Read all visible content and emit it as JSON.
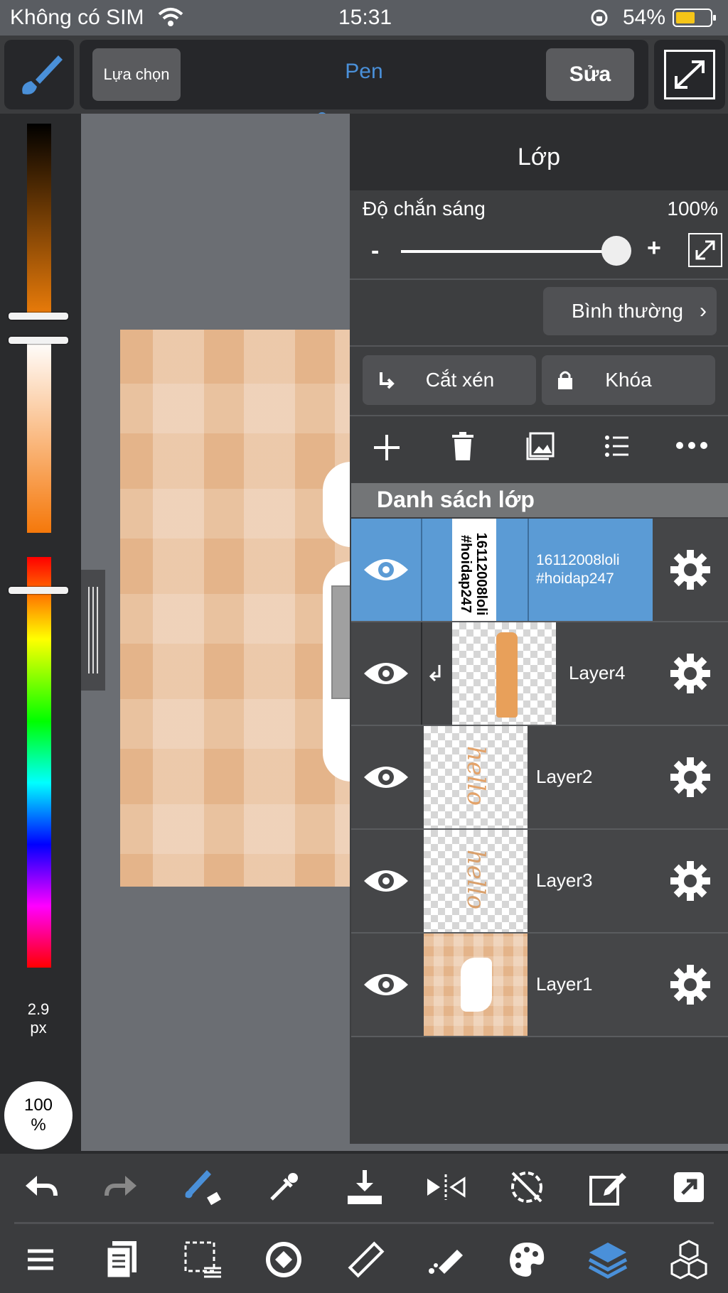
{
  "status": {
    "carrier": "Không có SIM",
    "time": "15:31",
    "battery": "54%"
  },
  "toolbar": {
    "selection_label": "Lựa chọn",
    "tool_name": "Pen",
    "edit_label": "Sửa"
  },
  "left": {
    "brush_size": "2.9",
    "brush_unit": "px",
    "opacity_value": "100",
    "opacity_unit": "%"
  },
  "panel": {
    "title": "Lớp",
    "opacity_label": "Độ chắn sáng",
    "opacity_value": "100%",
    "opacity_level": 1.0,
    "minus": "-",
    "plus": "+",
    "blend_mode": "Bình thường",
    "clip_label": "Cắt xén",
    "lock_label": "Khóa",
    "list_header": "Danh sách lớp",
    "layers": [
      {
        "name_line1": "16112008loli",
        "name_line2": "#hoidap247",
        "thumb_line1": "16112008loli",
        "thumb_line2": "#hoidap247"
      },
      {
        "name": "Layer4"
      },
      {
        "name": "Layer2",
        "thumb_text": "hello"
      },
      {
        "name": "Layer3",
        "thumb_text": "hello"
      },
      {
        "name": "Layer1"
      }
    ]
  },
  "colors": {
    "accent": "#4a90d9",
    "selected_row": "#5b9bd5",
    "peach": "#e7b68c"
  }
}
